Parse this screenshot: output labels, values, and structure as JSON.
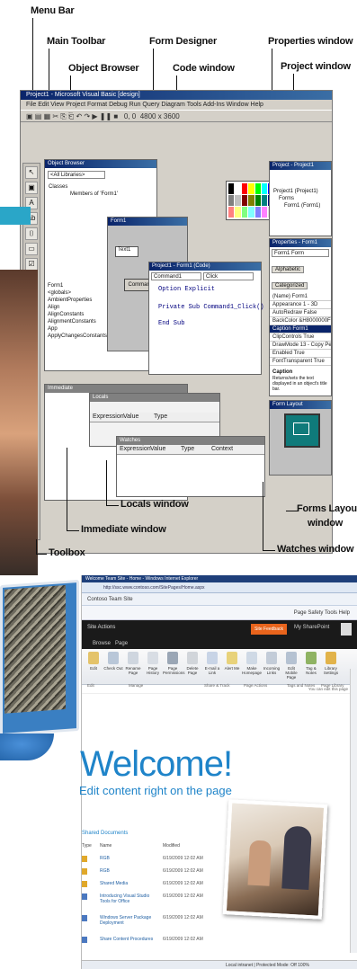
{
  "ide_diagram": {
    "callouts": {
      "menu_bar": "Menu Bar",
      "main_toolbar": "Main Toolbar",
      "object_browser": "Object Browser",
      "form_designer": "Form Designer",
      "code_window": "Code window",
      "properties_window": "Properties window",
      "project_window": "Project window",
      "locals_window": "Locals window",
      "immediate_window": "Immediate window",
      "toolbox": "Toolbox",
      "watches_window": "Watches window",
      "form_layout_window_line1": "Forms Layout",
      "form_layout_window_line2": "window"
    },
    "ide_title": "Project1 - Microsoft Visual Basic [design]",
    "ide_menu": "File  Edit  View  Project  Format  Debug  Run  Query  Diagram  Tools  Add-Ins  Window  Help",
    "ide_toolbar_coords": "0, 0",
    "ide_toolbar_size": "4800 x 3600",
    "object_browser_title": "Object Browser",
    "object_browser_combo": "<All Libraries>",
    "object_browser_classes": "Classes",
    "object_browser_members_label": "Members of 'Form1'",
    "object_browser_list": [
      "Form1",
      "<globals>",
      "AmbientProperties",
      "Align",
      "AlignConstants",
      "AlignmentConstants",
      "App",
      "ApplyChangesConstants"
    ],
    "form_designer_title": "Form1",
    "form_designer_button": "Command1",
    "form_caption_label": "Text1",
    "code_window_title": "Project1 - Form1 (Code)",
    "code_window_object": "Command1",
    "code_window_proc": "Click",
    "code_lines": [
      "Option Explicit",
      "Private Sub Command1_Click()",
      "End Sub"
    ],
    "project_window_title": "Project - Project1",
    "project_tree": [
      "Project1 (Project1)",
      "Forms",
      "Form1 (Form1)"
    ],
    "properties_title": "Properties - Form1",
    "properties_combo": "Form1  Form",
    "properties_tabs": [
      "Alphabetic",
      "Categorized"
    ],
    "properties_rows": [
      "(Name)     Form1",
      "Appearance  1 - 3D",
      "AutoRedraw  False",
      "BackColor   &H8000000F",
      "Caption     Form1",
      "ClipControls True",
      "DrawMode    13 - Copy Pen",
      "Enabled     True",
      "FontTransparent True"
    ],
    "properties_desc_title": "Caption",
    "properties_desc": "Returns/sets the text displayed in an object's title bar.",
    "form_layout_title": "Form Layout",
    "immediate_title": "Immediate",
    "locals_title": "Locals",
    "locals_columns": [
      "Expression",
      "Value",
      "Type"
    ],
    "watches_title": "Watches",
    "watches_columns": [
      "Expression",
      "Value",
      "Type",
      "Context"
    ]
  },
  "sharepoint": {
    "browser_title": "Welcome Team Site - Home - Windows Internet Explorer",
    "address": "http://ssc.www.contoso.com/SitePages/Home.aspx",
    "tab_label": "Contoso Team Site",
    "command_bar": "Page   Safety   Tools   Help",
    "site_actions": "Site Actions",
    "browse_tab": "Browse",
    "page_tab": "Page",
    "orange_button": "Site Feedback",
    "user_name": "My SharePoint",
    "ribbon_buttons": [
      "Edit",
      "Check Out",
      "Rename Page",
      "Page History",
      "Page Permissions",
      "Delete Page",
      "E-mail a Link",
      "Alert Me",
      "Make Homepage",
      "Incoming Links",
      "Edit Mobile Page",
      "Tag & Notes",
      "Library Settings"
    ],
    "ribbon_groups": [
      "Edit",
      "Manage",
      "Share & Track",
      "Page Actions",
      "Tags and Notes",
      "Page Library"
    ],
    "content_path": "You can edit this page",
    "welcome_title": "Welcome!",
    "welcome_subtitle": "Edit content right on the page",
    "docs_title": "Shared Documents",
    "docs_columns": [
      "Type",
      "Name",
      "Modified"
    ],
    "docs": [
      {
        "name": "RGB",
        "date": "6/19/2009 12:02 AM",
        "icon": "folder-icon"
      },
      {
        "name": "RGB",
        "date": "6/19/2009 12:02 AM",
        "icon": "folder-icon"
      },
      {
        "name": "Shared Media",
        "date": "6/19/2009 12:02 AM",
        "icon": "folder-icon"
      },
      {
        "name": "Introducing Visual Studio Tools for Office",
        "date": "6/19/2009 12:02 AM",
        "icon": "word-doc-icon"
      },
      {
        "name": "Windows Server Package Deployment",
        "date": "6/19/2009 12:02 AM",
        "icon": "word-doc-icon"
      },
      {
        "name": "Share Content Procedures",
        "date": "6/19/2009 12:02 AM",
        "icon": "word-doc-icon"
      }
    ],
    "status_bar": "Local intranet | Protected Mode: Off    100%",
    "colors": {
      "accent_blue": "#1f84c9",
      "orange": "#e9641c",
      "ribbon_dark": "#1a1a1a"
    }
  }
}
